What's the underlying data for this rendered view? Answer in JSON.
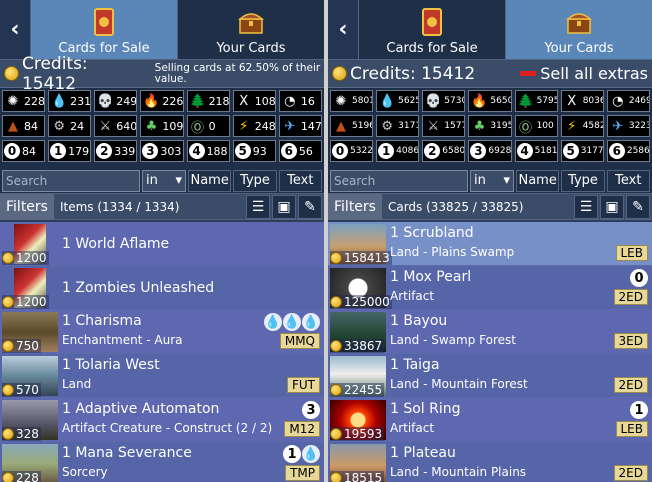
{
  "left": {
    "back_label": "‹",
    "tabs": [
      {
        "label": "Cards for Sale",
        "active": true
      },
      {
        "label": "Your Cards",
        "active": false
      }
    ],
    "credits_label": "Credits: 15412",
    "note": "Selling cards at 62.50% of their value.",
    "symbols": [
      {
        "glyph": "✺",
        "count": "228",
        "color": "#ffffff"
      },
      {
        "glyph": "💧",
        "count": "231",
        "color": "#9ad0ff"
      },
      {
        "glyph": "💀",
        "count": "249",
        "color": "#cfcfcf"
      },
      {
        "glyph": "🔥",
        "count": "226",
        "color": "#ff9090"
      },
      {
        "glyph": "🌲",
        "count": "218",
        "color": "#9ee89e"
      },
      {
        "glyph": "X",
        "count": "108",
        "color": "#ffffff"
      },
      {
        "glyph": "◔",
        "count": "16",
        "color": "#ffffff"
      },
      {
        "glyph": "▲",
        "count": "84",
        "color": "#c0501a"
      },
      {
        "glyph": "⚙",
        "count": "24",
        "color": "#cccccc"
      },
      {
        "glyph": "⚔",
        "count": "640",
        "color": "#dddddd"
      },
      {
        "glyph": "♣",
        "count": "109",
        "color": "#6c6"
      },
      {
        "glyph": "Ⓞ",
        "count": "0",
        "color": "#9c9"
      },
      {
        "glyph": "⚡",
        "count": "248",
        "color": "#ffcc00"
      },
      {
        "glyph": "✈",
        "count": "147",
        "color": "#55aaff"
      },
      {
        "glyph": "0",
        "count": "84",
        "circle": true
      },
      {
        "glyph": "1",
        "count": "179",
        "circle": true
      },
      {
        "glyph": "2",
        "count": "339",
        "circle": true
      },
      {
        "glyph": "3",
        "count": "303",
        "circle": true
      },
      {
        "glyph": "4",
        "count": "188",
        "circle": true
      },
      {
        "glyph": "5",
        "count": "93",
        "circle": true
      },
      {
        "glyph": "6",
        "count": "56",
        "circle": true
      }
    ],
    "search_placeholder": "Search",
    "in_label": "in",
    "sort_buttons": [
      "Name",
      "Type",
      "Text"
    ],
    "filters_label": "Filters",
    "count_label": "Items (1334 / 1334)",
    "rows": [
      {
        "name": "1 World Aflame",
        "type": "",
        "price": "1200",
        "set": "",
        "cost": [],
        "art": "pack"
      },
      {
        "name": "1 Zombies Unleashed",
        "type": "",
        "price": "1200",
        "set": "",
        "cost": [],
        "art": "pack"
      },
      {
        "name": "1 Charisma",
        "type": "Enchantment - Aura",
        "price": "750",
        "set": "MMQ",
        "cost": [
          "💧",
          "💧",
          "💧"
        ],
        "art": "crowd"
      },
      {
        "name": "1 Tolaria West",
        "type": "Land",
        "price": "570",
        "set": "FUT",
        "cost": [],
        "art": "sea"
      },
      {
        "name": "1 Adaptive Automaton",
        "type": "Artifact Creature - Construct (2 / 2)",
        "price": "328",
        "set": "M12",
        "cost": [
          "3"
        ],
        "art": "robot"
      },
      {
        "name": "1 Mana Severance",
        "type": "Sorcery",
        "price": "228",
        "set": "TMP",
        "cost": [
          "1",
          "💧"
        ],
        "art": "field"
      }
    ]
  },
  "right": {
    "back_label": "‹",
    "tabs": [
      {
        "label": "Cards for Sale",
        "active": false
      },
      {
        "label": "Your Cards",
        "active": true
      }
    ],
    "credits_label": "Credits: 15412",
    "sell_label": "Sell all extras",
    "symbols": [
      {
        "glyph": "✺",
        "count": "5801",
        "color": "#ffffff"
      },
      {
        "glyph": "💧",
        "count": "5625",
        "color": "#9ad0ff"
      },
      {
        "glyph": "💀",
        "count": "5730",
        "color": "#cfcfcf"
      },
      {
        "glyph": "🔥",
        "count": "5650",
        "color": "#ff9090"
      },
      {
        "glyph": "🌲",
        "count": "5795",
        "color": "#9ee89e"
      },
      {
        "glyph": "X",
        "count": "8036",
        "color": "#ffffff"
      },
      {
        "glyph": "◔",
        "count": "2469",
        "color": "#ffffff"
      },
      {
        "glyph": "▲",
        "count": "5196",
        "color": "#c0501a"
      },
      {
        "glyph": "⚙",
        "count": "3171",
        "color": "#cccccc"
      },
      {
        "glyph": "⚔",
        "count": "1577",
        "color": "#dddddd"
      },
      {
        "glyph": "♣",
        "count": "3195",
        "color": "#6c6"
      },
      {
        "glyph": "Ⓞ",
        "count": "100",
        "color": "#9c9"
      },
      {
        "glyph": "⚡",
        "count": "4582",
        "color": "#ffcc00"
      },
      {
        "glyph": "✈",
        "count": "3223",
        "color": "#55aaff"
      },
      {
        "glyph": "0",
        "count": "5322",
        "circle": true
      },
      {
        "glyph": "1",
        "count": "4086",
        "circle": true
      },
      {
        "glyph": "2",
        "count": "6580",
        "circle": true
      },
      {
        "glyph": "3",
        "count": "6928",
        "circle": true
      },
      {
        "glyph": "4",
        "count": "5181",
        "circle": true
      },
      {
        "glyph": "5",
        "count": "3177",
        "circle": true
      },
      {
        "glyph": "6",
        "count": "2586",
        "circle": true
      }
    ],
    "search_placeholder": "Search",
    "in_label": "in",
    "sort_buttons": [
      "Name",
      "Type",
      "Text"
    ],
    "filters_label": "Filters",
    "count_label": "Cards (33825 / 33825)",
    "rows": [
      {
        "name": "1 Scrubland",
        "type": "Land - Plains Swamp",
        "price": "158413",
        "set": "LEB",
        "cost": [],
        "art": "plain",
        "selected": true
      },
      {
        "name": "1 Mox Pearl",
        "type": "Artifact",
        "price": "125000",
        "set": "2ED",
        "cost": [
          "0"
        ],
        "art": "pearl"
      },
      {
        "name": "1 Bayou",
        "type": "Land - Swamp Forest",
        "price": "33867",
        "set": "3ED",
        "cost": [],
        "art": "swamp"
      },
      {
        "name": "1 Taiga",
        "type": "Land - Mountain Forest",
        "price": "22455",
        "set": "2ED",
        "cost": [],
        "art": "mountain"
      },
      {
        "name": "1 Sol Ring",
        "type": "Artifact",
        "price": "19593",
        "set": "LEB",
        "cost": [
          "1"
        ],
        "art": "ring"
      },
      {
        "name": "1 Plateau",
        "type": "Land - Mountain Plains",
        "price": "18515",
        "set": "2ED",
        "cost": [],
        "art": "plateau"
      }
    ]
  }
}
